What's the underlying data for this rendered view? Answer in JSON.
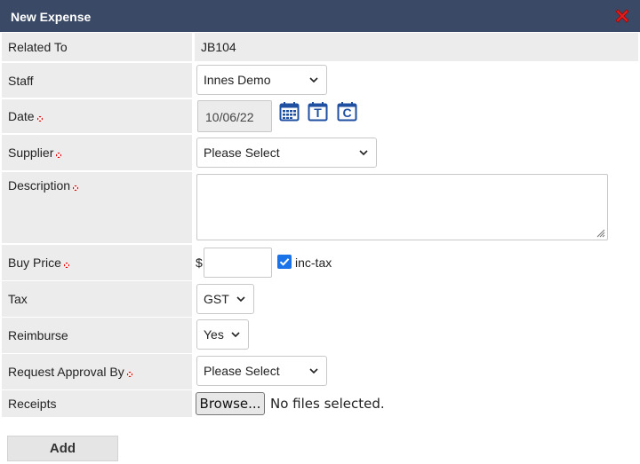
{
  "dialog": {
    "title": "New Expense",
    "close_icon": "close-icon"
  },
  "fields": {
    "related_to": {
      "label": "Related To",
      "value": "JB104"
    },
    "staff": {
      "label": "Staff",
      "value": "Innes Demo"
    },
    "date": {
      "label": "Date",
      "required": true,
      "value": "10/06/22",
      "calendar_icon": "calendar-icon",
      "today_button": "T",
      "clear_button": "C"
    },
    "supplier": {
      "label": "Supplier",
      "required": true,
      "value": "Please Select"
    },
    "description": {
      "label": "Description",
      "required": true,
      "value": ""
    },
    "buy_price": {
      "label": "Buy Price",
      "required": true,
      "currency": "$",
      "value": "",
      "inc_tax_label": "inc-tax",
      "inc_tax_checked": true
    },
    "tax": {
      "label": "Tax",
      "value": "GST"
    },
    "reimburse": {
      "label": "Reimburse",
      "value": "Yes"
    },
    "request_approval_by": {
      "label": "Request Approval By",
      "required": true,
      "value": "Please Select"
    },
    "receipts": {
      "label": "Receipts",
      "browse_label": "Browse...",
      "file_status": "No files selected."
    }
  },
  "actions": {
    "add_label": "Add"
  },
  "colors": {
    "title_bar": "#3a4a66",
    "label_bg": "#ececec",
    "required_marker": "#dd1111",
    "checkbox": "#1a73e8",
    "icon_blue": "#1f4fa0"
  }
}
